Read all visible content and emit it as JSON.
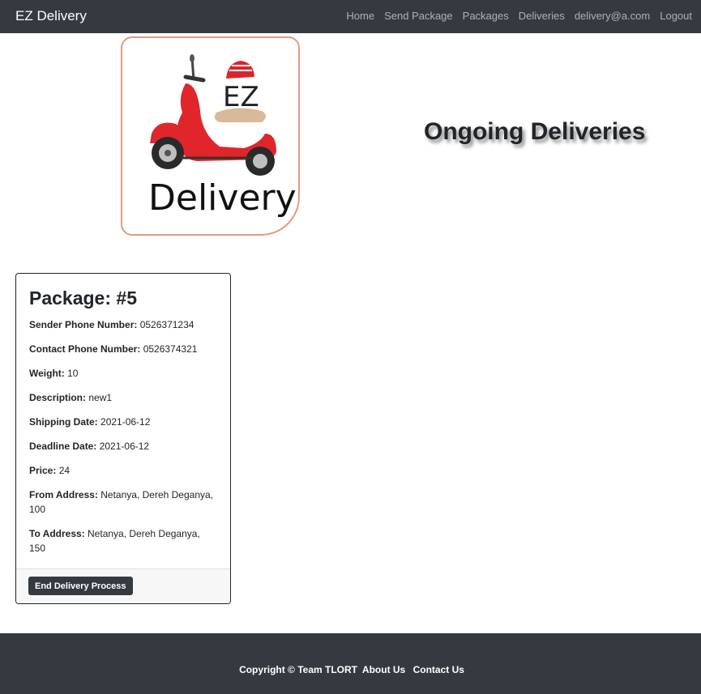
{
  "navbar": {
    "brand": "EZ Delivery",
    "links": [
      "Home",
      "Send Package",
      "Packages",
      "Deliveries",
      "delivery@a.com",
      "Logout"
    ]
  },
  "logo": {
    "line1": "EZ",
    "line2": "Delivery"
  },
  "page_title": "Ongoing Deliveries",
  "package": {
    "title_prefix": "Package: #",
    "id": "5",
    "fields": [
      {
        "label": "Sender Phone Number:",
        "value": "0526371234"
      },
      {
        "label": "Contact Phone Number:",
        "value": "0526374321"
      },
      {
        "label": "Weight:",
        "value": "10"
      },
      {
        "label": "Description:",
        "value": "new1"
      },
      {
        "label": "Shipping Date:",
        "value": "2021-06-12"
      },
      {
        "label": "Deadline Date:",
        "value": "2021-06-12"
      },
      {
        "label": "Price:",
        "value": "24"
      },
      {
        "label": "From Address:",
        "value": "Netanya, Dereh Deganya, 100"
      },
      {
        "label": "To Address:",
        "value": "Netanya, Dereh Deganya, 150"
      }
    ],
    "action_label": "End Delivery Process"
  },
  "footer": {
    "copyright": "Copyright © Team TLORT",
    "about": "About Us",
    "contact": "Contact Us"
  },
  "colors": {
    "navbar_bg": "#343a40",
    "scooter_red": "#e0262b",
    "logo_border": "#e39b7b"
  },
  "icons": {
    "logo": "red-scooter-logo"
  }
}
